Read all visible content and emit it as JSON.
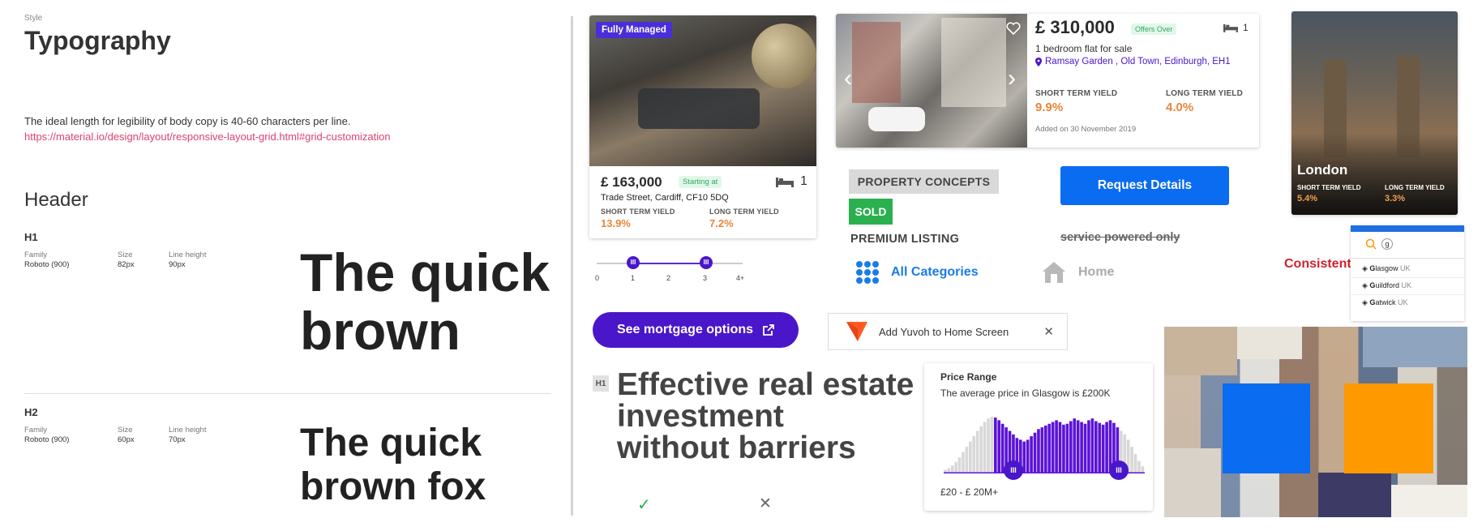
{
  "typography": {
    "style_label": "Style",
    "title": "Typography",
    "body_copy": "The ideal length for legibility of body copy is 40-60 characters per line.",
    "link": "https://material.io/design/layout/responsive-layout-grid.html#grid-customization",
    "header_title": "Header",
    "family_label": "Family",
    "size_label": "Size",
    "line_height_label": "Line height",
    "h1": {
      "name": "H1",
      "family": "Roboto (900)",
      "size": "82px",
      "line_height": "90px",
      "sample_line1": "The quick",
      "sample_line2": "brown"
    },
    "h2": {
      "name": "H2",
      "family": "Roboto (900)",
      "size": "60px",
      "line_height": "70px",
      "sample_line1": "The quick",
      "sample_line2": "brown fox"
    }
  },
  "card1": {
    "badge": "Fully Managed",
    "price": "£ 163,000",
    "price_pill": "Starting at",
    "beds": "1",
    "address": "Trade Street, Cardiff, CF10 5DQ",
    "short_label": "SHORT TERM YIELD",
    "short_value": "13.9%",
    "long_label": "LONG TERM YIELD",
    "long_value": "7.2%"
  },
  "slider": {
    "ticks": [
      "0",
      "1",
      "2",
      "3",
      "4+"
    ],
    "low": "1",
    "high": "3",
    "knob_glyph": "III"
  },
  "card2": {
    "price": "£ 310,000",
    "price_pill": "Offers Over",
    "beds": "1",
    "description": "1 bedroom flat for sale",
    "location": "Ramsay Garden , Old Town, Edinburgh, EH1",
    "short_label": "SHORT TERM YIELD",
    "short_value": "9.9%",
    "long_label": "LONG TERM YIELD",
    "long_value": "4.0%",
    "added": "Added on 30 November 2019",
    "prev_glyph": "‹",
    "next_glyph": "›"
  },
  "london_card": {
    "city": "London",
    "short_label": "SHORT TERM YIELD",
    "short_value": "5.4%",
    "long_label": "LONG TERM YIELD",
    "long_value": "3.3%"
  },
  "tags": {
    "property_concepts": "PROPERTY CONCEPTS",
    "sold": "SOLD",
    "premium": "PREMIUM LISTING",
    "service": "service powered only",
    "request_button": "Request Details"
  },
  "nav": {
    "categories": "All Categories",
    "home": "Home"
  },
  "mortgage_button": "See mortgage options",
  "add_to_home": {
    "text": "Add Yuvoh to Home Screen",
    "close_glyph": "✕"
  },
  "hero": {
    "tag": "H1",
    "headline_line1": "Effective real estate",
    "headline_line2": "investment",
    "headline_line3": "without barriers",
    "check_glyph": "✓",
    "cross_glyph": "✕"
  },
  "price_range": {
    "title": "Price Range",
    "subtitle": "The average price in Glasgow is £200K",
    "range": "£20 - £ 20M+",
    "knob_glyph": "III",
    "histogram": [
      4,
      6,
      9,
      13,
      18,
      24,
      30,
      36,
      42,
      48,
      53,
      58,
      62,
      64,
      63,
      60,
      56,
      52,
      48,
      44,
      40,
      38,
      36,
      38,
      42,
      46,
      50,
      52,
      54,
      56,
      58,
      60,
      58,
      55,
      56,
      59,
      62,
      60,
      58,
      56,
      60,
      62,
      59,
      57,
      55,
      58,
      60,
      57,
      52,
      48,
      44,
      38,
      30,
      22,
      14,
      8
    ],
    "selected_from_bin": 14,
    "selected_to_bin": 48,
    "colors": {
      "selected": "#5b13d8",
      "unselected": "#d8d8d8"
    }
  },
  "consistent": "Consistent",
  "search": {
    "query": "g",
    "suggestions": [
      {
        "bold": "G",
        "rest": "lasgow",
        "country": "UK"
      },
      {
        "bold": "G",
        "rest": "uildford",
        "country": "UK"
      },
      {
        "bold": "G",
        "rest": "atwick",
        "country": "UK"
      }
    ]
  },
  "colors": {
    "primary_purple": "#4a16c9",
    "primary_blue": "#0a6cf0",
    "orange_yield": "#e8863a",
    "sold_green": "#2bb04f",
    "brand_orange": "#ff9900",
    "accent_red": "#d0202e"
  }
}
